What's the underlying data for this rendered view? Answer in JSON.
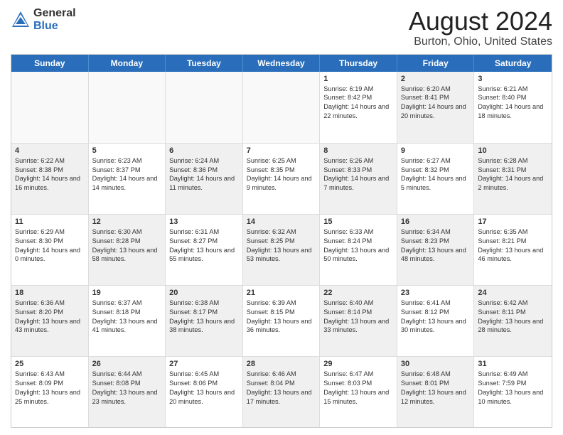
{
  "header": {
    "logo_general": "General",
    "logo_blue": "Blue",
    "title": "August 2024",
    "location": "Burton, Ohio, United States"
  },
  "days_of_week": [
    "Sunday",
    "Monday",
    "Tuesday",
    "Wednesday",
    "Thursday",
    "Friday",
    "Saturday"
  ],
  "weeks": [
    [
      {
        "day": "",
        "text": "",
        "empty": true
      },
      {
        "day": "",
        "text": "",
        "empty": true
      },
      {
        "day": "",
        "text": "",
        "empty": true
      },
      {
        "day": "",
        "text": "",
        "empty": true
      },
      {
        "day": "1",
        "text": "Sunrise: 6:19 AM\nSunset: 8:42 PM\nDaylight: 14 hours and 22 minutes.",
        "shaded": false
      },
      {
        "day": "2",
        "text": "Sunrise: 6:20 AM\nSunset: 8:41 PM\nDaylight: 14 hours and 20 minutes.",
        "shaded": true
      },
      {
        "day": "3",
        "text": "Sunrise: 6:21 AM\nSunset: 8:40 PM\nDaylight: 14 hours and 18 minutes.",
        "shaded": false
      }
    ],
    [
      {
        "day": "4",
        "text": "Sunrise: 6:22 AM\nSunset: 8:38 PM\nDaylight: 14 hours and 16 minutes.",
        "shaded": true
      },
      {
        "day": "5",
        "text": "Sunrise: 6:23 AM\nSunset: 8:37 PM\nDaylight: 14 hours and 14 minutes.",
        "shaded": false
      },
      {
        "day": "6",
        "text": "Sunrise: 6:24 AM\nSunset: 8:36 PM\nDaylight: 14 hours and 11 minutes.",
        "shaded": true
      },
      {
        "day": "7",
        "text": "Sunrise: 6:25 AM\nSunset: 8:35 PM\nDaylight: 14 hours and 9 minutes.",
        "shaded": false
      },
      {
        "day": "8",
        "text": "Sunrise: 6:26 AM\nSunset: 8:33 PM\nDaylight: 14 hours and 7 minutes.",
        "shaded": true
      },
      {
        "day": "9",
        "text": "Sunrise: 6:27 AM\nSunset: 8:32 PM\nDaylight: 14 hours and 5 minutes.",
        "shaded": false
      },
      {
        "day": "10",
        "text": "Sunrise: 6:28 AM\nSunset: 8:31 PM\nDaylight: 14 hours and 2 minutes.",
        "shaded": true
      }
    ],
    [
      {
        "day": "11",
        "text": "Sunrise: 6:29 AM\nSunset: 8:30 PM\nDaylight: 14 hours and 0 minutes.",
        "shaded": false
      },
      {
        "day": "12",
        "text": "Sunrise: 6:30 AM\nSunset: 8:28 PM\nDaylight: 13 hours and 58 minutes.",
        "shaded": true
      },
      {
        "day": "13",
        "text": "Sunrise: 6:31 AM\nSunset: 8:27 PM\nDaylight: 13 hours and 55 minutes.",
        "shaded": false
      },
      {
        "day": "14",
        "text": "Sunrise: 6:32 AM\nSunset: 8:25 PM\nDaylight: 13 hours and 53 minutes.",
        "shaded": true
      },
      {
        "day": "15",
        "text": "Sunrise: 6:33 AM\nSunset: 8:24 PM\nDaylight: 13 hours and 50 minutes.",
        "shaded": false
      },
      {
        "day": "16",
        "text": "Sunrise: 6:34 AM\nSunset: 8:23 PM\nDaylight: 13 hours and 48 minutes.",
        "shaded": true
      },
      {
        "day": "17",
        "text": "Sunrise: 6:35 AM\nSunset: 8:21 PM\nDaylight: 13 hours and 46 minutes.",
        "shaded": false
      }
    ],
    [
      {
        "day": "18",
        "text": "Sunrise: 6:36 AM\nSunset: 8:20 PM\nDaylight: 13 hours and 43 minutes.",
        "shaded": true
      },
      {
        "day": "19",
        "text": "Sunrise: 6:37 AM\nSunset: 8:18 PM\nDaylight: 13 hours and 41 minutes.",
        "shaded": false
      },
      {
        "day": "20",
        "text": "Sunrise: 6:38 AM\nSunset: 8:17 PM\nDaylight: 13 hours and 38 minutes.",
        "shaded": true
      },
      {
        "day": "21",
        "text": "Sunrise: 6:39 AM\nSunset: 8:15 PM\nDaylight: 13 hours and 36 minutes.",
        "shaded": false
      },
      {
        "day": "22",
        "text": "Sunrise: 6:40 AM\nSunset: 8:14 PM\nDaylight: 13 hours and 33 minutes.",
        "shaded": true
      },
      {
        "day": "23",
        "text": "Sunrise: 6:41 AM\nSunset: 8:12 PM\nDaylight: 13 hours and 30 minutes.",
        "shaded": false
      },
      {
        "day": "24",
        "text": "Sunrise: 6:42 AM\nSunset: 8:11 PM\nDaylight: 13 hours and 28 minutes.",
        "shaded": true
      }
    ],
    [
      {
        "day": "25",
        "text": "Sunrise: 6:43 AM\nSunset: 8:09 PM\nDaylight: 13 hours and 25 minutes.",
        "shaded": false
      },
      {
        "day": "26",
        "text": "Sunrise: 6:44 AM\nSunset: 8:08 PM\nDaylight: 13 hours and 23 minutes.",
        "shaded": true
      },
      {
        "day": "27",
        "text": "Sunrise: 6:45 AM\nSunset: 8:06 PM\nDaylight: 13 hours and 20 minutes.",
        "shaded": false
      },
      {
        "day": "28",
        "text": "Sunrise: 6:46 AM\nSunset: 8:04 PM\nDaylight: 13 hours and 17 minutes.",
        "shaded": true
      },
      {
        "day": "29",
        "text": "Sunrise: 6:47 AM\nSunset: 8:03 PM\nDaylight: 13 hours and 15 minutes.",
        "shaded": false
      },
      {
        "day": "30",
        "text": "Sunrise: 6:48 AM\nSunset: 8:01 PM\nDaylight: 13 hours and 12 minutes.",
        "shaded": true
      },
      {
        "day": "31",
        "text": "Sunrise: 6:49 AM\nSunset: 7:59 PM\nDaylight: 13 hours and 10 minutes.",
        "shaded": false
      }
    ]
  ]
}
